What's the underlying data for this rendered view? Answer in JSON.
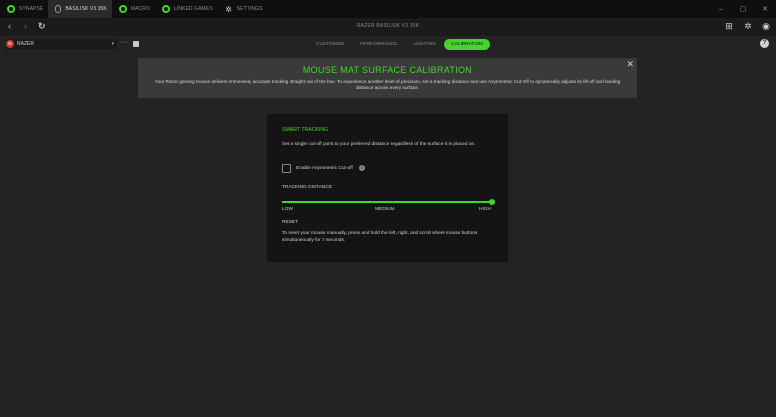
{
  "app_tabs": [
    {
      "label": "SYNAPSE",
      "icon": "synapse-logo-icon"
    },
    {
      "label": "BASILISK V3 35K",
      "icon": "mouse-icon"
    },
    {
      "label": "MACRO",
      "icon": "macro-icon"
    },
    {
      "label": "LINKED GAMES",
      "icon": "linked-games-icon"
    },
    {
      "label": "SETTINGS",
      "icon": "gear-icon"
    }
  ],
  "window_controls": {
    "minimize": "–",
    "maximize": "▢",
    "close": "✕"
  },
  "nav": {
    "back": "‹",
    "forward": "›",
    "refresh": "↻",
    "device_title": "RAZER BASILISK V3 35K"
  },
  "topright_icons": [
    "grid-icon",
    "gear-icon",
    "profile-icon"
  ],
  "profile": {
    "name": "RAZER",
    "caret": "▾",
    "more": "···"
  },
  "device_tabs": {
    "items": [
      "CUSTOMIZE",
      "PERFORMANCE",
      "LIGHTING",
      "CALIBRATION"
    ],
    "active": "CALIBRATION"
  },
  "help": "?",
  "banner": {
    "title": "MOUSE MAT SURFACE CALIBRATION",
    "description": "Your Razer gaming mouse delivers immensely accurate tracking straight out of the box. To experience another level of precision, set a tracking distance and use Asymmetric Cut-Off to dynamically adjusts its lift-off and landing distance across every surface.",
    "close": "✕"
  },
  "smart_tracking": {
    "heading": "SMART TRACKING",
    "description": "Set a single cut-off point to your preferred distance regardless of the surface it is placed on.",
    "checkbox_label": "Enable Asymmetric Cut-off",
    "checkbox_checked": false,
    "info": "i",
    "tracking_distance_label": "TRACKING DISTANCE",
    "slider_value": 1.0,
    "slider_labels": {
      "low": "LOW",
      "medium": "MEDIUM",
      "high": "HIGH"
    },
    "reset_heading": "RESET",
    "reset_description": "To reset your mouse manually, press and hold the left, right, and scroll wheel mouse buttons simultaneously for 7 seconds."
  },
  "colors": {
    "accent": "#44d62c",
    "background": "#232323",
    "panel": "#141414",
    "banner": "#3a3a3a"
  }
}
